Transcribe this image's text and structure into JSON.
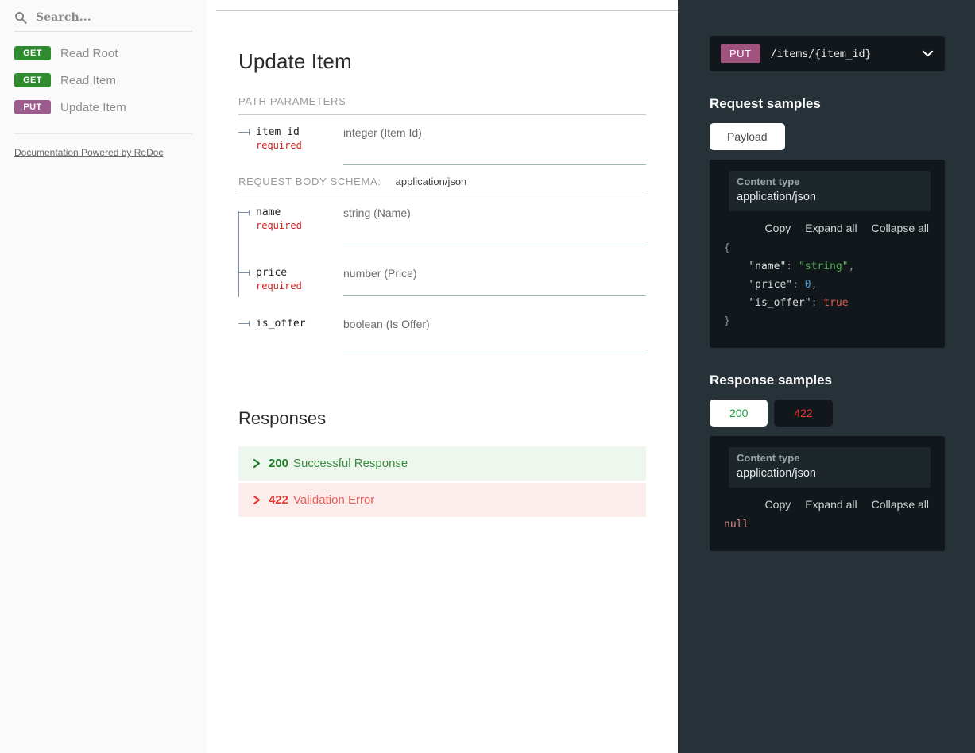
{
  "sidebar": {
    "search": {
      "placeholder": "Search...",
      "icon": "search-icon"
    },
    "items": [
      {
        "method": "GET",
        "label": "Read Root",
        "method_class": "get"
      },
      {
        "method": "GET",
        "label": "Read Item",
        "method_class": "get"
      },
      {
        "method": "PUT",
        "label": "Update Item",
        "method_class": "put"
      }
    ],
    "footer_link": "Documentation Powered by ReDoc"
  },
  "main": {
    "title": "Update Item",
    "path_parameters_caption": "PATH PARAMETERS",
    "path_parameters": [
      {
        "name": "item_id",
        "required": "required",
        "type": "integer (Item Id)"
      }
    ],
    "request_body_caption": "REQUEST BODY SCHEMA:",
    "request_body_content_type": "application/json",
    "body_parameters": [
      {
        "name": "name",
        "required": "required",
        "type": "string (Name)"
      },
      {
        "name": "price",
        "required": "required",
        "type": "number (Price)"
      },
      {
        "name": "is_offer",
        "required": "",
        "type": "boolean (Is Offer)"
      }
    ],
    "responses_title": "Responses",
    "responses": [
      {
        "code": "200",
        "description": "Successful Response",
        "state": "ok"
      },
      {
        "code": "422",
        "description": "Validation Error",
        "state": "err"
      }
    ]
  },
  "right_panel": {
    "endpoint": {
      "method": "PUT",
      "path": "/items/{item_id}",
      "chevron": "chevron-down-icon"
    },
    "request_samples": {
      "heading": "Request samples",
      "tab": "Payload",
      "content_type_label": "Content type",
      "content_type_value": "application/json",
      "actions": {
        "copy": "Copy",
        "expand": "Expand all",
        "collapse": "Collapse all"
      },
      "code": {
        "open_brace": "{",
        "lines": [
          {
            "key": "\"name\"",
            "sep": ": ",
            "value": "\"string\"",
            "value_type": "str",
            "comma": ","
          },
          {
            "key": "\"price\"",
            "sep": ": ",
            "value": "0",
            "value_type": "num",
            "comma": ","
          },
          {
            "key": "\"is_offer\"",
            "sep": ": ",
            "value": "true",
            "value_type": "bool",
            "comma": ""
          }
        ],
        "close_brace": "}"
      }
    },
    "response_samples": {
      "heading": "Response samples",
      "tabs": [
        {
          "label": "200",
          "state": "active"
        },
        {
          "label": "422",
          "state": "inactive"
        }
      ],
      "content_type_label": "Content type",
      "content_type_value": "application/json",
      "actions": {
        "copy": "Copy",
        "expand": "Expand all",
        "collapse": "Collapse all"
      },
      "code_value": "null"
    }
  },
  "colors": {
    "get_badge": "#2e8b2e",
    "put_badge": "#9b5b8c",
    "panel_bg": "#263238",
    "code_bg": "#11171a",
    "success": "#1d7d25",
    "error": "#e0392f"
  }
}
